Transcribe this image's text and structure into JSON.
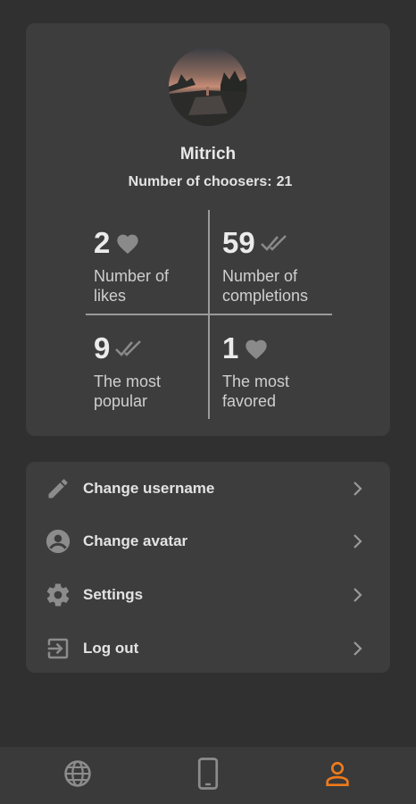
{
  "profile": {
    "username": "Mitrich",
    "choosers_label": "Number of choosers:",
    "choosers_count": "21"
  },
  "stats": [
    {
      "value": "2",
      "icon": "heart-icon",
      "label_line1": "Number of",
      "label_line2": "likes"
    },
    {
      "value": "59",
      "icon": "double-check-icon",
      "label_line1": "Number of",
      "label_line2": "completions"
    },
    {
      "value": "9",
      "icon": "double-check-icon",
      "label_line1": "The most",
      "label_line2": "popular"
    },
    {
      "value": "1",
      "icon": "heart-icon",
      "label_line1": "The most",
      "label_line2": "favored"
    }
  ],
  "menu": [
    {
      "label": "Change username",
      "icon": "pencil-icon"
    },
    {
      "label": "Change avatar",
      "icon": "account-circle-icon"
    },
    {
      "label": "Settings",
      "icon": "gear-icon"
    },
    {
      "label": "Log out",
      "icon": "logout-icon"
    }
  ],
  "bottom_nav": [
    {
      "icon": "globe-icon",
      "active": false
    },
    {
      "icon": "phone-icon",
      "active": false
    },
    {
      "icon": "person-icon",
      "active": true
    }
  ],
  "colors": {
    "background": "#303030",
    "card": "#3d3d3d",
    "accent": "#f07a1a",
    "icon_gray": "#8c8c8c"
  }
}
